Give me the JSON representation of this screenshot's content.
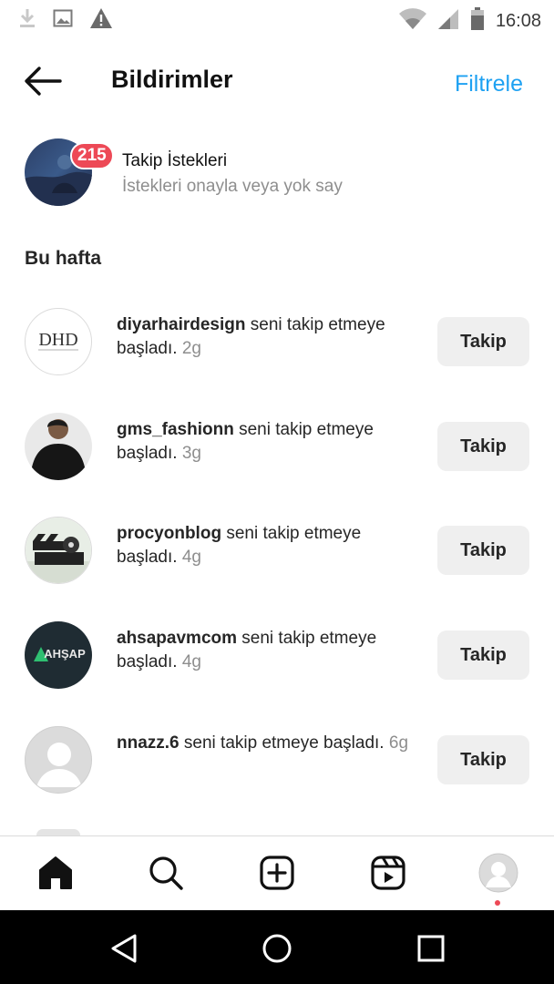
{
  "status_bar": {
    "time": "16:08",
    "icons": [
      "download-icon",
      "image-icon",
      "warning-icon",
      "wifi-icon",
      "signal-icon",
      "battery-icon"
    ]
  },
  "header": {
    "title": "Bildirimler",
    "filter_label": "Filtrele"
  },
  "follow_requests": {
    "badge_count": "215",
    "title": "Takip İstekleri",
    "subtitle": "İstekleri onayla veya yok say"
  },
  "section": {
    "title": "Bu hafta"
  },
  "notifications": [
    {
      "username": "diyarhairdesign",
      "message": " seni takip etmeye başladı. ",
      "time": "2g",
      "button": "Takip",
      "avatar_text": "DHD"
    },
    {
      "username": "gms_fashionn",
      "message": " seni takip etmeye başladı. ",
      "time": "3g",
      "button": "Takip"
    },
    {
      "username": "procyonblog",
      "message": " seni takip etmeye başladı. ",
      "time": "4g",
      "button": "Takip"
    },
    {
      "username": "ahsapavmcom",
      "message": " seni takip etmeye başladı. ",
      "time": "4g",
      "button": "Takip",
      "avatar_text": "AHŞAP"
    },
    {
      "username": "nnazz.6",
      "message": " seni takip etmeye başladı. ",
      "time": "6g",
      "button": "Takip"
    }
  ],
  "bottom_nav": {
    "items": [
      "home-icon",
      "search-icon",
      "new-post-icon",
      "reels-icon",
      "profile-icon"
    ]
  },
  "colors": {
    "accent": "#1ea1f2",
    "badge": "#ed4956",
    "button_bg": "#efefef",
    "secondary_text": "#8e8e8e"
  }
}
